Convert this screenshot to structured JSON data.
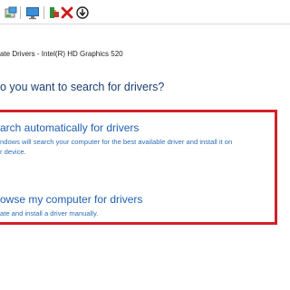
{
  "toolbar": {
    "icons": [
      "device-manager-icon",
      "scan-hardware-icon",
      "add-legacy-icon",
      "uninstall-icon",
      "disable-icon"
    ]
  },
  "breadcrumb": "ate Drivers - Intel(R) HD Graphics 520",
  "question": "o you want to search for drivers?",
  "options": [
    {
      "title": "arch automatically for drivers",
      "desc_line1": "ndows will search your computer for the best available driver and install it on",
      "desc_line2": "r device."
    },
    {
      "title": "owse my computer for drivers",
      "desc_line1": "ate and install a driver manually."
    }
  ],
  "colors": {
    "title_blue": "#1f5fb3",
    "desc_blue": "#2f6fb5",
    "heading_navy": "#1a3f73",
    "highlight_red": "#d21f2b"
  }
}
